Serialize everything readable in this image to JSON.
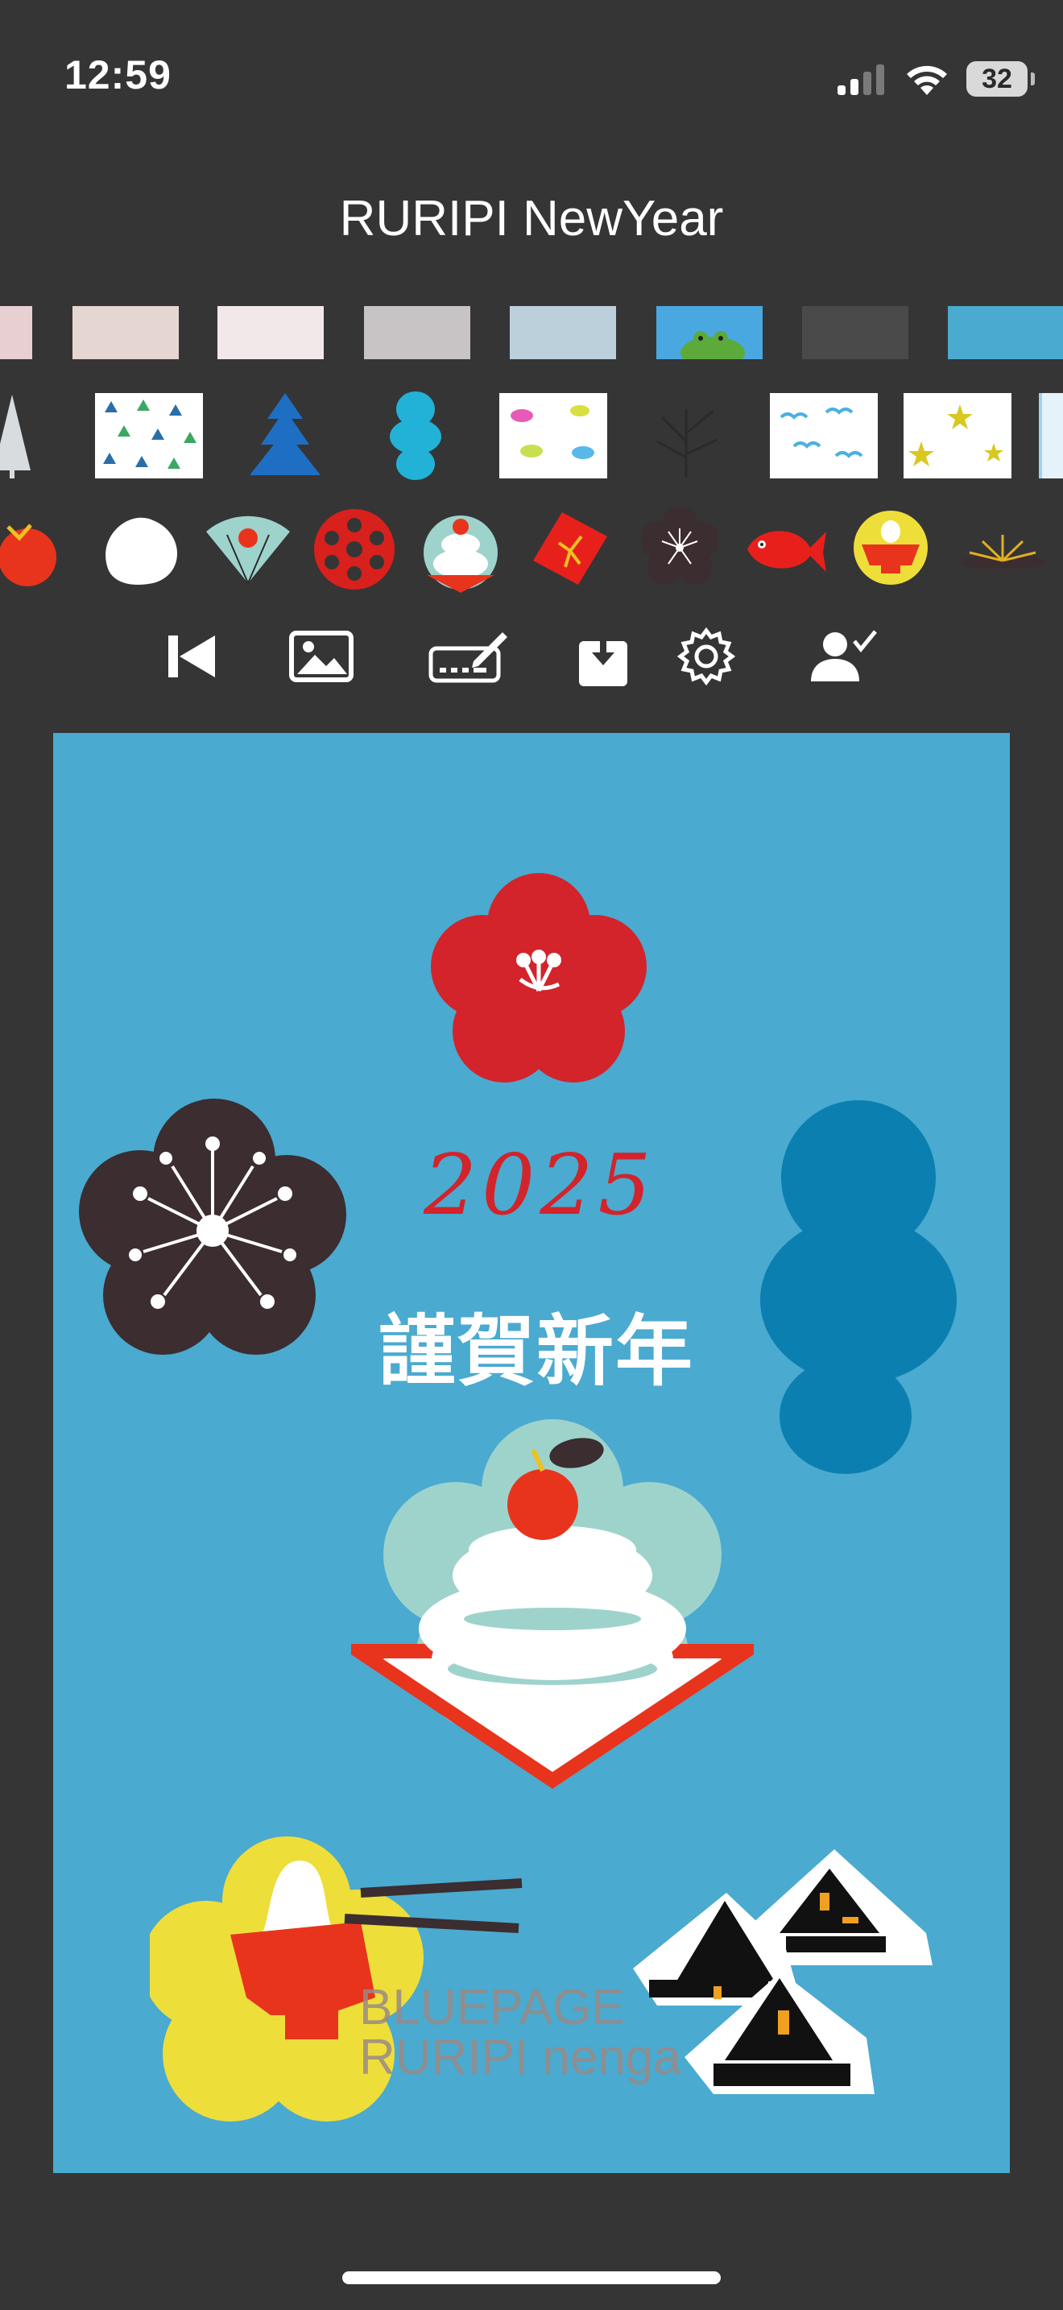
{
  "status_bar": {
    "time": "12:59",
    "battery": "32",
    "icons": [
      "signal-icon",
      "wifi-icon",
      "battery-icon"
    ]
  },
  "app": {
    "title": "RURIPI NewYear"
  },
  "background_swatches": [
    {
      "name": "pink-light",
      "color": "#e8cfd2"
    },
    {
      "name": "beige",
      "color": "#e6d6d2"
    },
    {
      "name": "white-pink",
      "color": "#f2e8ea"
    },
    {
      "name": "grey",
      "color": "#c8c4c6"
    },
    {
      "name": "light-blue",
      "color": "#bcd0dc"
    },
    {
      "name": "sky-frog",
      "color": "#4aa8e0"
    },
    {
      "name": "dark-grey",
      "color": "#4a4a4a"
    },
    {
      "name": "blue",
      "color": "#4aaad0"
    }
  ],
  "pattern_swatches": [
    "tree-pattern",
    "triangle-pattern",
    "blue-tree-pattern",
    "cyan-gourd-pattern",
    "fish-pattern",
    "branch-pattern",
    "bird-pattern",
    "star-pattern",
    "blue-edge-pattern"
  ],
  "stamps": [
    "gourd-stamp",
    "mochi-stamp",
    "fan-stamp",
    "lotus-stamp",
    "kagami-mochi-stamp",
    "envelope-stamp",
    "plum-flower-stamp",
    "tai-fish-stamp",
    "ozoni-stamp",
    "firework-stamp"
  ],
  "toolbar": {
    "buttons": [
      "skip-back-button",
      "image-button",
      "keyboard-pen-button",
      "download-button",
      "settings-button",
      "user-check-button"
    ]
  },
  "card": {
    "background_color": "#4aaad0",
    "year": "2025",
    "greeting": "謹賀新年",
    "watermark_line1": "BLUEPAGE",
    "watermark_line2": "RURIPI nenga"
  }
}
